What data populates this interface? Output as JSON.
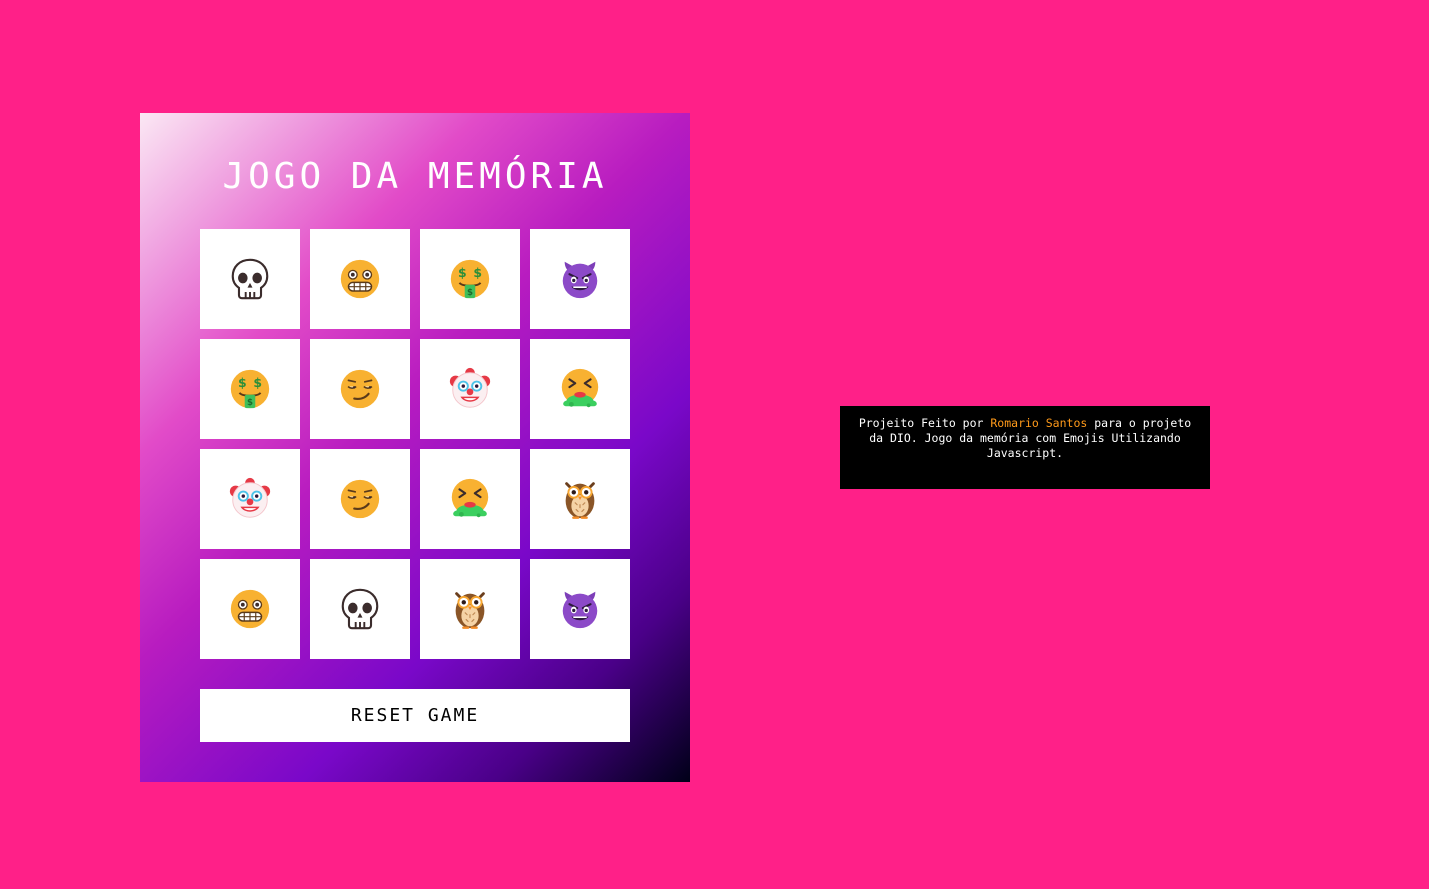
{
  "game": {
    "title": "JOGO DA MEMÓRIA",
    "reset_label": "RESET GAME",
    "cards": [
      {
        "emoji": "💀",
        "icon": "skull-icon"
      },
      {
        "emoji": "😬",
        "icon": "grimacing-face-icon"
      },
      {
        "emoji": "🤑",
        "icon": "money-mouth-face-icon"
      },
      {
        "emoji": "😈",
        "icon": "smiling-devil-icon"
      },
      {
        "emoji": "🤑",
        "icon": "money-mouth-face-icon"
      },
      {
        "emoji": "😏",
        "icon": "smirking-face-icon"
      },
      {
        "emoji": "🤡",
        "icon": "clown-face-icon"
      },
      {
        "emoji": "🤮",
        "icon": "vomiting-face-icon"
      },
      {
        "emoji": "🤡",
        "icon": "clown-face-icon"
      },
      {
        "emoji": "😏",
        "icon": "smirking-face-icon"
      },
      {
        "emoji": "🤮",
        "icon": "vomiting-face-icon"
      },
      {
        "emoji": "🦉",
        "icon": "owl-icon"
      },
      {
        "emoji": "😬",
        "icon": "grimacing-face-icon"
      },
      {
        "emoji": "💀",
        "icon": "skull-icon"
      },
      {
        "emoji": "🦉",
        "icon": "owl-icon"
      },
      {
        "emoji": "😈",
        "icon": "smiling-devil-icon"
      }
    ]
  },
  "credits": {
    "prefix": "Projeito Feito por ",
    "author": "Romario Santos",
    "suffix": " para o projeto da DIO. Jogo da memória com Emojis Utilizando Javascript.",
    "author_color": "#ff9a1a"
  },
  "colors": {
    "background": "#ff2088",
    "card": "#ffffff",
    "credits_background": "#000000"
  }
}
